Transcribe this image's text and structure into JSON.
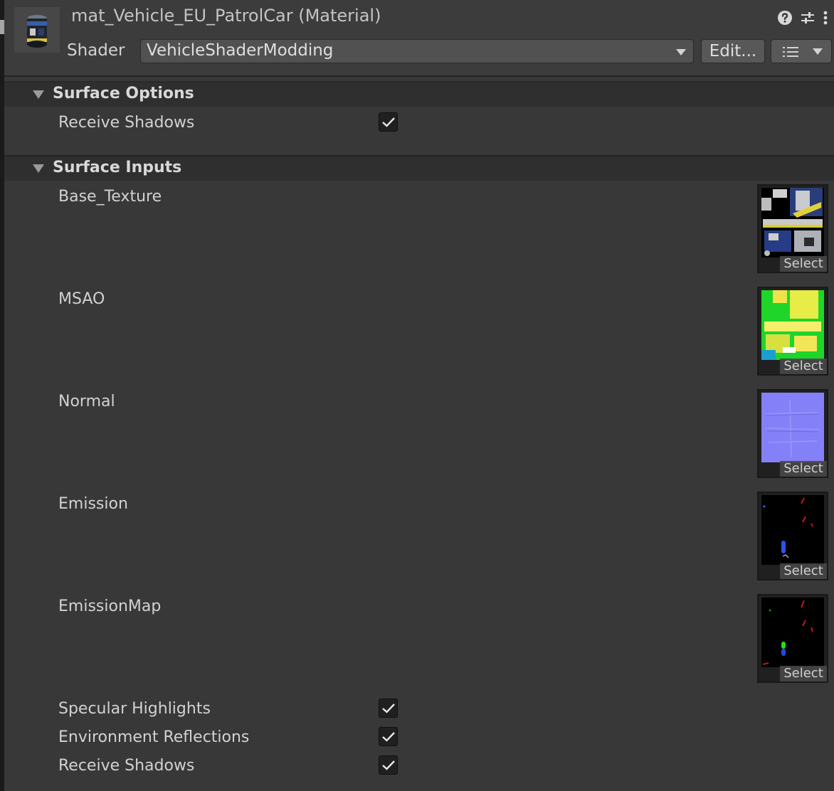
{
  "header": {
    "title": "mat_Vehicle_EU_PatrolCar (Material)",
    "shader_label": "Shader",
    "shader_value": "VehicleShaderModding",
    "edit_label": "Edit...",
    "icons": [
      "help-icon",
      "preset-icon",
      "more-menu-icon",
      "list-icon",
      "chevron-down-icon"
    ]
  },
  "surface_options": {
    "title": "Surface Options",
    "receive_shadows_label": "Receive Shadows",
    "receive_shadows_checked": true
  },
  "surface_inputs": {
    "title": "Surface Inputs",
    "textures": [
      {
        "label": "Base_Texture",
        "select": "Select"
      },
      {
        "label": "MSAO",
        "select": "Select"
      },
      {
        "label": "Normal",
        "select": "Select"
      },
      {
        "label": "Emission",
        "select": "Select"
      },
      {
        "label": "EmissionMap",
        "select": "Select"
      }
    ],
    "toggles": [
      {
        "label": "Specular Highlights",
        "checked": true
      },
      {
        "label": "Environment Reflections",
        "checked": true
      },
      {
        "label": "Receive Shadows",
        "checked": true
      }
    ]
  },
  "colors": {
    "background": "#383838",
    "header": "#3c3c3c",
    "section_header": "#2f2f2f",
    "text": "#d2d2d2"
  }
}
